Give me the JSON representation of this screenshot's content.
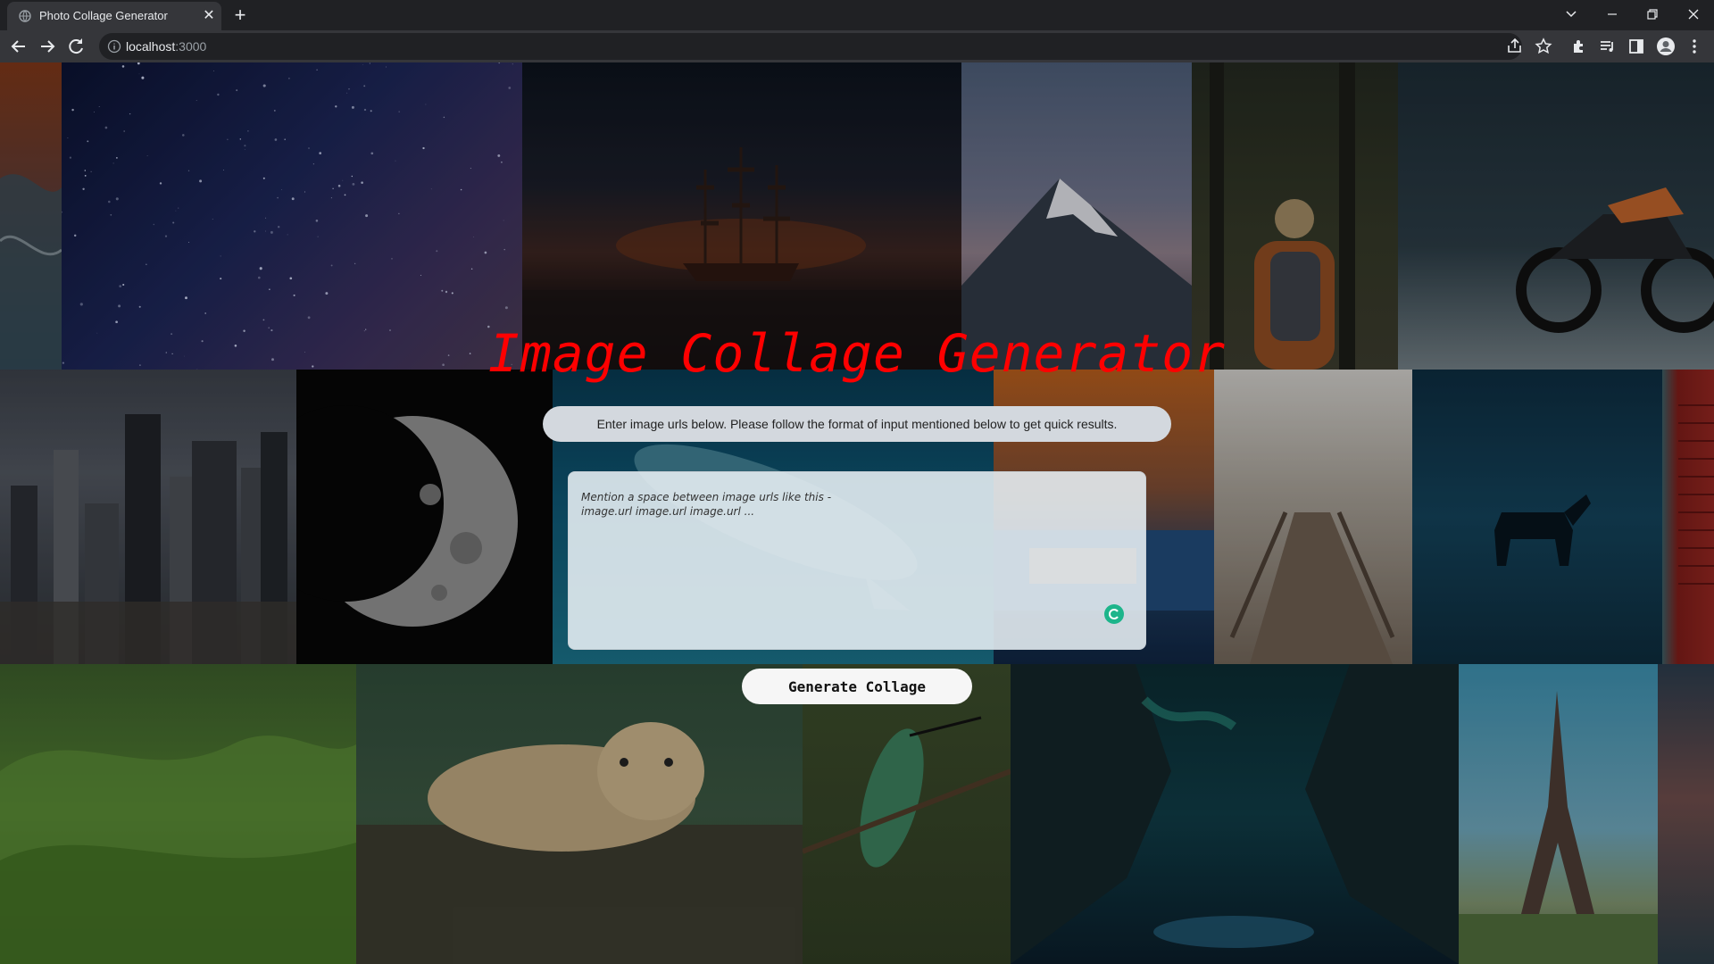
{
  "browser": {
    "tab_title": "Photo Collage Generator",
    "new_tab_symbol": "+",
    "close_symbol": "✕",
    "url_host": "localhost",
    "url_port": ":3000"
  },
  "page": {
    "title": "Image Collage Generator",
    "instructions": "Enter image urls below. Please follow the format of input mentioned below to get quick results.",
    "input_placeholder": "Mention a space between image urls like this -\nimage.url image.url image.url ...",
    "generate_button": "Generate Collage"
  },
  "icons": {
    "back": "arrow-left-icon",
    "forward": "arrow-right-icon",
    "reload": "reload-icon",
    "info": "info-icon",
    "share": "share-icon",
    "bookmark": "star-icon",
    "extensions": "puzzle-icon",
    "media": "media-queue-icon",
    "side_panel": "side-panel-icon",
    "profile": "avatar-icon",
    "menu": "kebab-menu-icon"
  },
  "colors": {
    "title": "#ff0000",
    "chrome_bg": "#202124",
    "toolbar_bg": "#35363a"
  },
  "collage_photos": [
    "ocean-wave",
    "milky-way-sky",
    "sailing-ship-sunset",
    "snowy-mountain",
    "hiker-in-forest",
    "motorcycle",
    "city-skyline",
    "half-moon",
    "underwater-dolphin",
    "orange-building",
    "wooden-boardwalk",
    "horse-in-fog",
    "red-shutter",
    "green-hills",
    "leopard-on-log",
    "hummingbird",
    "aurora-cave",
    "eiffel-tower",
    "sunset-edge"
  ]
}
